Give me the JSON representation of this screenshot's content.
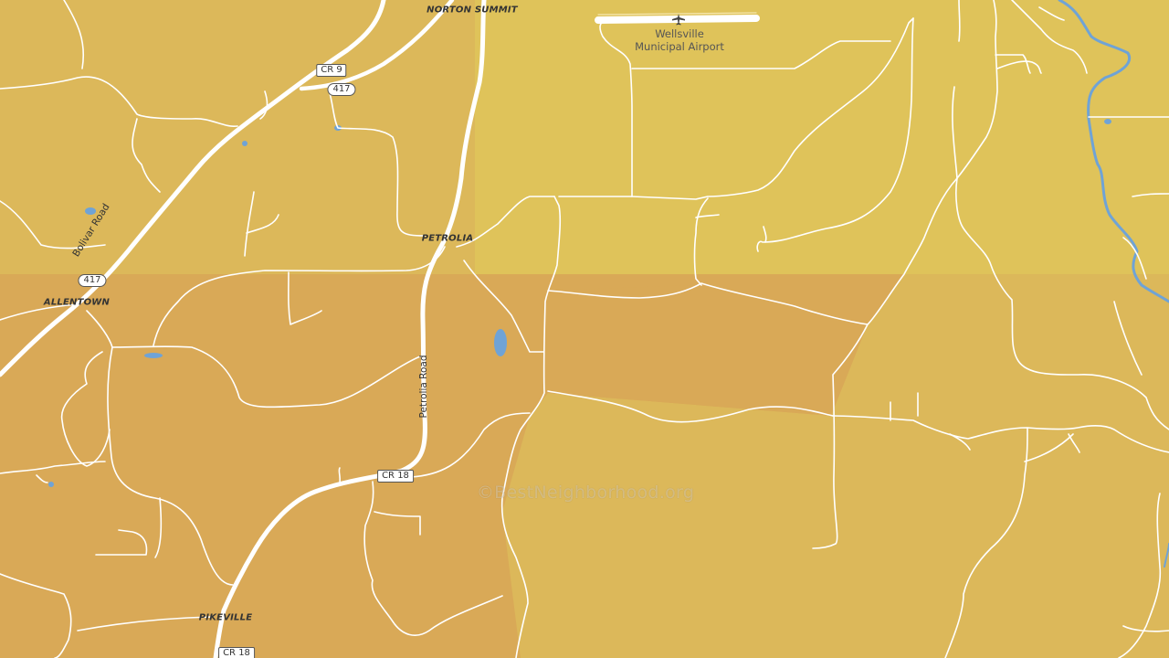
{
  "map": {
    "places": {
      "norton_summit": "NORTON SUMMIT",
      "petrolia": "PETROLIA",
      "allentown": "ALLENTOWN",
      "pikeville": "PIKEVILLE"
    },
    "roads": {
      "bolivar_road": "Bolivar Road",
      "petrolia_road": "Petrolia Road"
    },
    "shields": {
      "cr9": "CR 9",
      "route417_a": "417",
      "route417_b": "417",
      "cr18_a": "CR 18",
      "cr18_b": "CR 18"
    },
    "airport": {
      "name_line1": "Wellsville",
      "name_line2": "Municipal Airport",
      "icon": "airplane-icon"
    },
    "watermark": "©BestNeighborhood.org",
    "colors": {
      "tier_light": "#dfc35a",
      "tier_mid": "#dcb85a",
      "tier_dark": "#d9a957",
      "road": "#ffffff",
      "water": "#6fa3d6"
    }
  }
}
